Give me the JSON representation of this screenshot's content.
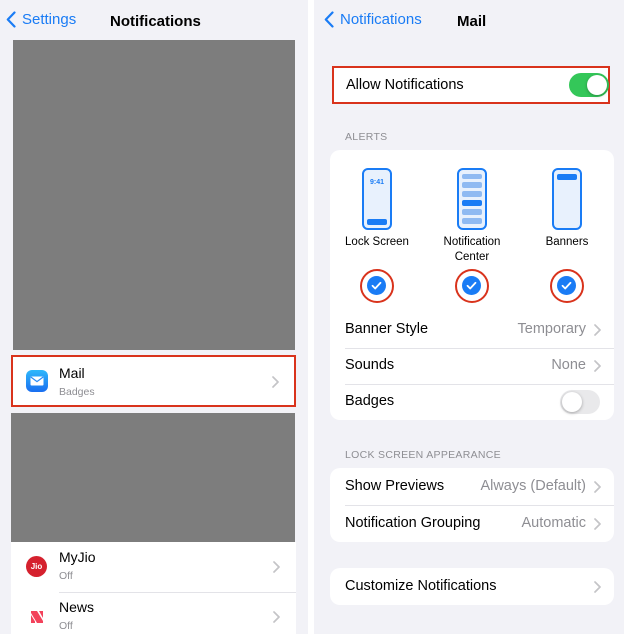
{
  "left": {
    "nav": {
      "back_label": "Settings",
      "title": "Notifications"
    },
    "mail_row": {
      "title": "Mail",
      "subtitle": "Badges",
      "icon": "mail-app-icon"
    },
    "apps": [
      {
        "title": "MyJio",
        "subtitle": "Off",
        "icon": "myjio-app-icon",
        "icon_text": "Jio",
        "color": "#d5212e"
      },
      {
        "title": "News",
        "subtitle": "Off",
        "icon": "news-app-icon",
        "color": "#f3425b"
      }
    ]
  },
  "right": {
    "nav": {
      "back_label": "Notifications",
      "title": "Mail"
    },
    "allow_notifications": {
      "label": "Allow Notifications",
      "on": true
    },
    "alerts_header": "ALERTS",
    "alert_styles": [
      {
        "label": "Lock Screen",
        "phone_time": "9:41",
        "checked": true
      },
      {
        "label": "Notification Center",
        "checked": true
      },
      {
        "label": "Banners",
        "checked": true
      }
    ],
    "banner_style": {
      "label": "Banner Style",
      "value": "Temporary"
    },
    "sounds": {
      "label": "Sounds",
      "value": "None"
    },
    "badges": {
      "label": "Badges",
      "on": false
    },
    "lock_screen_header": "LOCK SCREEN APPEARANCE",
    "show_previews": {
      "label": "Show Previews",
      "value": "Always (Default)"
    },
    "notification_grouping": {
      "label": "Notification Grouping",
      "value": "Automatic"
    },
    "customize": {
      "label": "Customize Notifications"
    }
  },
  "colors": {
    "accent": "#1a7cf5",
    "toggle_on": "#34c759",
    "highlight": "#d9331c",
    "redacted": "#7d7d7d",
    "background": "#f2f2f7"
  }
}
